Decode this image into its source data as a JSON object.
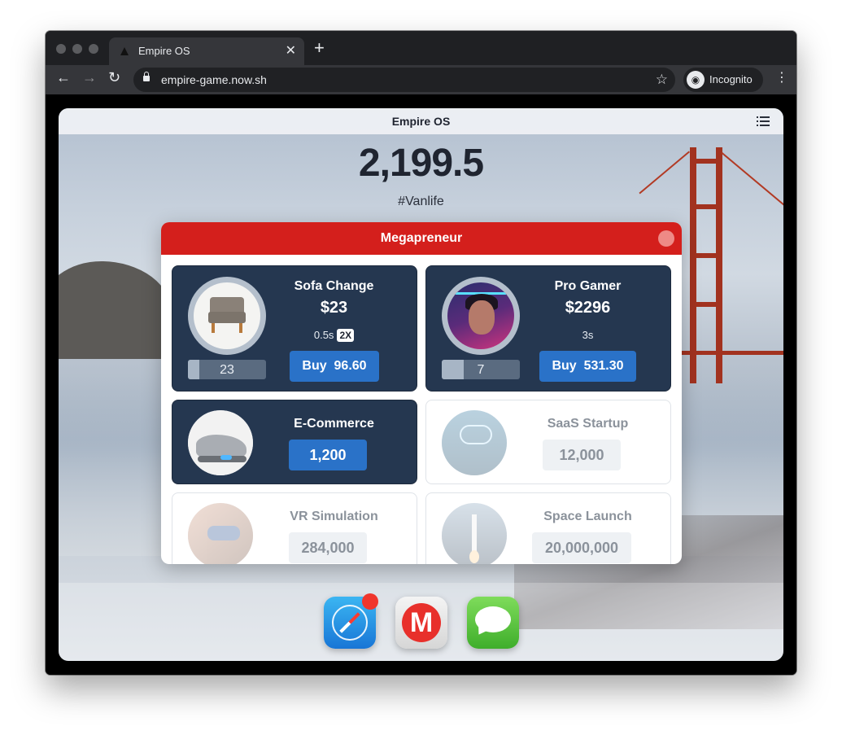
{
  "browser": {
    "tab": {
      "title": "Empire OS",
      "close_glyph": "✕"
    },
    "new_tab_glyph": "+",
    "toolbar": {
      "back_glyph": "←",
      "forward_glyph": "→",
      "reload_glyph": "↻",
      "url": "empire-game.now.sh",
      "star_glyph": "☆",
      "incognito_label": "Incognito",
      "incognito_glyph": "◉",
      "menu_glyph": "⋮"
    }
  },
  "app": {
    "title": "Empire OS",
    "balance": "2,199.5",
    "status": "#Vanlife"
  },
  "modal": {
    "title": "Megapreneur",
    "businesses": [
      {
        "name": "Sofa Change",
        "price": "$23",
        "time": "0.5s",
        "multiplier": "2X",
        "owned": "23",
        "progress": 0.15,
        "buy_label": "Buy",
        "buy_cost": "96.60"
      },
      {
        "name": "Pro Gamer",
        "price": "$2296",
        "time": "3s",
        "owned": "7",
        "progress": 0.28,
        "buy_label": "Buy",
        "buy_cost": "531.30"
      },
      {
        "name": "E-Commerce",
        "unlock_cost": "1,200",
        "state": "affordable"
      },
      {
        "name": "SaaS Startup",
        "unlock_cost": "12,000",
        "state": "locked"
      },
      {
        "name": "VR Simulation",
        "unlock_cost": "284,000",
        "state": "locked"
      },
      {
        "name": "Space Launch",
        "unlock_cost": "20,000,000",
        "state": "locked"
      }
    ]
  },
  "dock": {
    "apps": [
      {
        "name": "Safari",
        "icon": "compass-icon",
        "has_notification": true
      },
      {
        "name": "Megapreneur",
        "icon": "m-logo-icon",
        "glyph": "M"
      },
      {
        "name": "Messages",
        "icon": "speech-bubble-icon"
      }
    ]
  },
  "colors": {
    "modal_header": "#d41f1c",
    "card_dark": "#253750",
    "button_blue": "#2a72c8",
    "notification_red": "#f0362c"
  }
}
